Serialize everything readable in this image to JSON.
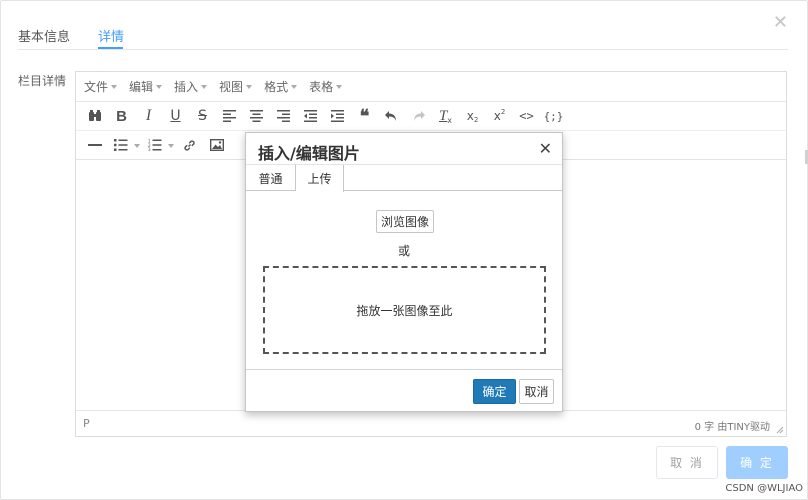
{
  "tabs": [
    {
      "label": "基本信息"
    },
    {
      "label": "详情"
    }
  ],
  "field_label": "栏目详情",
  "editor": {
    "menus": [
      {
        "label": "文件"
      },
      {
        "label": "编辑"
      },
      {
        "label": "插入"
      },
      {
        "label": "视图"
      },
      {
        "label": "格式"
      },
      {
        "label": "表格"
      }
    ],
    "status_path": "P",
    "status_right": "0 字 由TINY驱动"
  },
  "modal": {
    "title": "插入/编辑图片",
    "tab_general": "普通",
    "tab_upload": "上传",
    "browse_label": "浏览图像",
    "or_label": "或",
    "dropzone_label": "拖放一张图像至此",
    "ok_label": "确定",
    "cancel_label": "取消"
  },
  "footer": {
    "cancel_label": "取 消",
    "ok_label": "确 定"
  },
  "watermark": "CSDN @WLJIAO",
  "colors": {
    "accent": "#409eff",
    "ok_disabled": "#a0cfff",
    "modal_ok": "#207ab7"
  }
}
